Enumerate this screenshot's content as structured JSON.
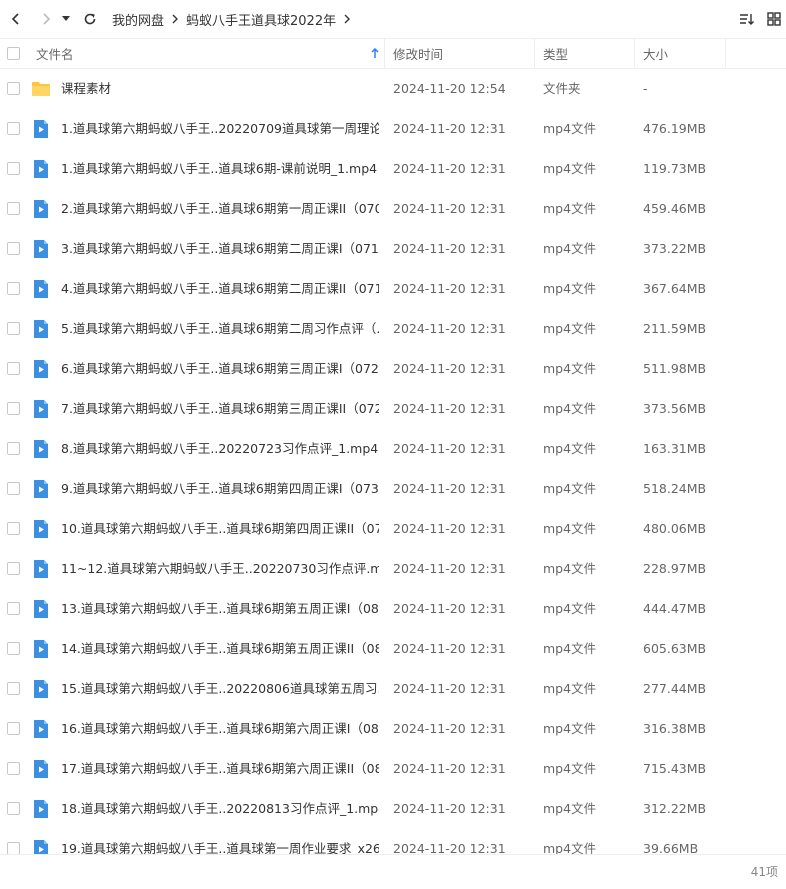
{
  "toolbar": {
    "breadcrumbs": [
      "我的网盘",
      "蚂蚁八手王道具球2022年"
    ]
  },
  "columns": {
    "name": "文件名",
    "modified": "修改时间",
    "type": "类型",
    "size": "大小"
  },
  "colors": {
    "folder": "#FFC53D",
    "video": "#3D8FE0",
    "accent": "#2B83F6"
  },
  "files": [
    {
      "name": "课程素材",
      "modified": "2024-11-20 12:54",
      "type": "文件夹",
      "size": "-",
      "icon": "folder-icon"
    },
    {
      "name": "1.道具球第六期蚂蚁八手王..20220709道具球第一周理论...",
      "modified": "2024-11-20 12:31",
      "type": "mp4文件",
      "size": "476.19MB",
      "icon": "video-file-icon"
    },
    {
      "name": "1.道具球第六期蚂蚁八手王..道具球6期-课前说明_1.mp4",
      "modified": "2024-11-20 12:31",
      "type": "mp4文件",
      "size": "119.73MB",
      "icon": "video-file-icon"
    },
    {
      "name": "2.道具球第六期蚂蚁八手王..道具球6期第一周正课II（070...",
      "modified": "2024-11-20 12:31",
      "type": "mp4文件",
      "size": "459.46MB",
      "icon": "video-file-icon"
    },
    {
      "name": "3.道具球第六期蚂蚁八手王..道具球6期第二周正课I（071...",
      "modified": "2024-11-20 12:31",
      "type": "mp4文件",
      "size": "373.22MB",
      "icon": "video-file-icon"
    },
    {
      "name": "4.道具球第六期蚂蚁八手王..道具球6期第二周正课II（071...",
      "modified": "2024-11-20 12:31",
      "type": "mp4文件",
      "size": "367.64MB",
      "icon": "video-file-icon"
    },
    {
      "name": "5.道具球第六期蚂蚁八手王..道具球6期第二周习作点评（...",
      "modified": "2024-11-20 12:31",
      "type": "mp4文件",
      "size": "211.59MB",
      "icon": "video-file-icon"
    },
    {
      "name": "6.道具球第六期蚂蚁八手王..道具球6期第三周正课I（072...",
      "modified": "2024-11-20 12:31",
      "type": "mp4文件",
      "size": "511.98MB",
      "icon": "video-file-icon"
    },
    {
      "name": "7.道具球第六期蚂蚁八手王..道具球6期第三周正课II（072...",
      "modified": "2024-11-20 12:31",
      "type": "mp4文件",
      "size": "373.56MB",
      "icon": "video-file-icon"
    },
    {
      "name": "8.道具球第六期蚂蚁八手王..20220723习作点评_1.mp4",
      "modified": "2024-11-20 12:31",
      "type": "mp4文件",
      "size": "163.31MB",
      "icon": "video-file-icon"
    },
    {
      "name": "9.道具球第六期蚂蚁八手王..道具球6期第四周正课I（073...",
      "modified": "2024-11-20 12:31",
      "type": "mp4文件",
      "size": "518.24MB",
      "icon": "video-file-icon"
    },
    {
      "name": "10.道具球第六期蚂蚁八手王..道具球6期第四周正课II（07...",
      "modified": "2024-11-20 12:31",
      "type": "mp4文件",
      "size": "480.06MB",
      "icon": "video-file-icon"
    },
    {
      "name": "11~12.道具球第六期蚂蚁八手王..20220730习作点评.mp4",
      "modified": "2024-11-20 12:31",
      "type": "mp4文件",
      "size": "228.97MB",
      "icon": "video-file-icon"
    },
    {
      "name": "13.道具球第六期蚂蚁八手王..道具球6期第五周正课I（08...",
      "modified": "2024-11-20 12:31",
      "type": "mp4文件",
      "size": "444.47MB",
      "icon": "video-file-icon"
    },
    {
      "name": "14.道具球第六期蚂蚁八手王..道具球6期第五周正课II（08...",
      "modified": "2024-11-20 12:31",
      "type": "mp4文件",
      "size": "605.63MB",
      "icon": "video-file-icon"
    },
    {
      "name": "15.道具球第六期蚂蚁八手王..20220806道具球第五周习...",
      "modified": "2024-11-20 12:31",
      "type": "mp4文件",
      "size": "277.44MB",
      "icon": "video-file-icon"
    },
    {
      "name": "16.道具球第六期蚂蚁八手王..道具球6期第六周正课I（08...",
      "modified": "2024-11-20 12:31",
      "type": "mp4文件",
      "size": "316.38MB",
      "icon": "video-file-icon"
    },
    {
      "name": "17.道具球第六期蚂蚁八手王..道具球6期第六周正课II（08...",
      "modified": "2024-11-20 12:31",
      "type": "mp4文件",
      "size": "715.43MB",
      "icon": "video-file-icon"
    },
    {
      "name": "18.道具球第六期蚂蚁八手王..20220813习作点评_1.mp4",
      "modified": "2024-11-20 12:31",
      "type": "mp4文件",
      "size": "312.22MB",
      "icon": "video-file-icon"
    },
    {
      "name": "19.道具球第六期蚂蚁八手王..道具球第一周作业要求_x26...",
      "modified": "2024-11-20 12:31",
      "type": "mp4文件",
      "size": "39.66MB",
      "icon": "video-file-icon"
    }
  ],
  "footer": {
    "count": "41项"
  }
}
